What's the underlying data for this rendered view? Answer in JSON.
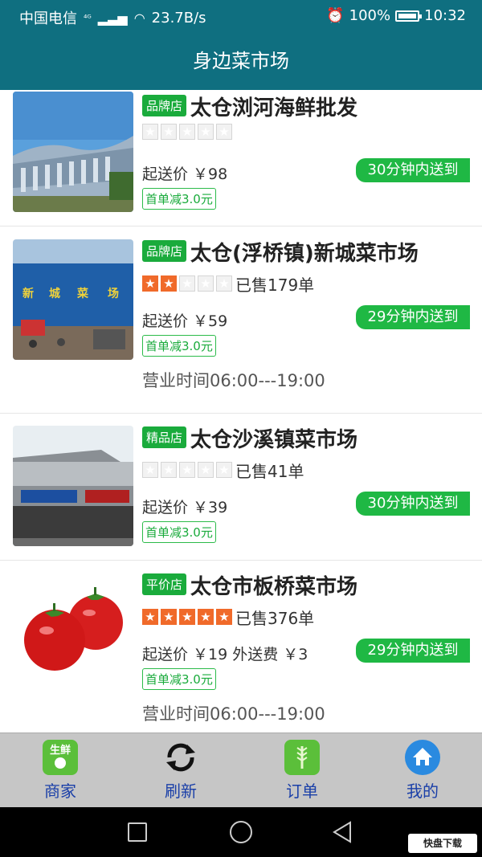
{
  "status": {
    "carrier": "中国电信",
    "net": "⁴ᴳ",
    "speed": "23.7B/s",
    "battery": "100%",
    "time": "10:32"
  },
  "header": {
    "title": "身边菜市场"
  },
  "stores": [
    {
      "badge": "品牌店",
      "name": "太仓浏河海鲜批发",
      "stars": 0,
      "sold": "",
      "min_price": "起送价 ￥98",
      "delivery": "30分钟内送到",
      "promo": "首单减3.0元",
      "hours": ""
    },
    {
      "badge": "品牌店",
      "name": "太仓(浮桥镇)新城菜市场",
      "stars": 2,
      "sold": "已售179单",
      "min_price": "起送价 ￥59",
      "delivery": "29分钟内送到",
      "promo": "首单减3.0元",
      "hours": "营业时间06:00---19:00"
    },
    {
      "badge": "精品店",
      "name": "太仓沙溪镇菜市场",
      "stars": 0,
      "sold": "已售41单",
      "min_price": "起送价 ￥39",
      "delivery": "30分钟内送到",
      "promo": "首单减3.0元",
      "hours": ""
    },
    {
      "badge": "平价店",
      "name": "太仓市板桥菜市场",
      "stars": 5,
      "sold": "已售376单",
      "min_price": "起送价 ￥19  外送费 ￥3",
      "delivery": "29分钟内送到",
      "promo": "首单减3.0元",
      "hours": "营业时间06:00---19:00"
    }
  ],
  "tabs": [
    {
      "label": "商家",
      "icon": "fresh-produce-icon",
      "icon_text": "生鲜"
    },
    {
      "label": "刷新",
      "icon": "refresh-icon"
    },
    {
      "label": "订单",
      "icon": "order-icon"
    },
    {
      "label": "我的",
      "icon": "home-icon"
    }
  ],
  "watermark": "快盘下载",
  "colors": {
    "primary": "#0f6f80",
    "green": "#1aab3c",
    "star": "#f06a2a",
    "tab_label": "#1a3fa8"
  }
}
